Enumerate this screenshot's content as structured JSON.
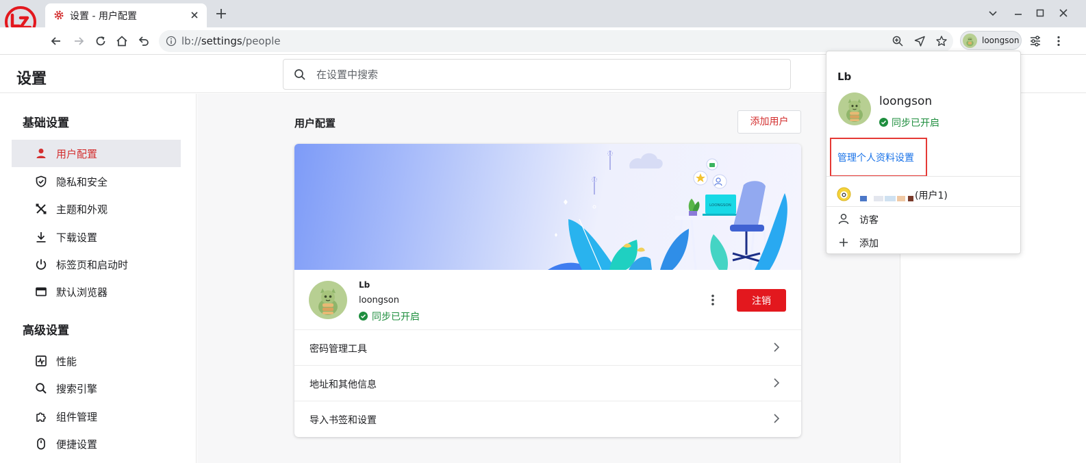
{
  "browser": {
    "tab_title": "设置 - 用户配置",
    "url_scheme": "lb://",
    "url_host": "settings",
    "url_path": "/people",
    "profile_chip_name": "loongson"
  },
  "settings": {
    "title": "设置",
    "search_placeholder": "在设置中搜索"
  },
  "sidebar": {
    "basic_title": "基础设置",
    "basic_items": [
      {
        "label": "用户配置",
        "icon": "person-icon",
        "active": true
      },
      {
        "label": "隐私和安全",
        "icon": "shield-icon"
      },
      {
        "label": "主题和外观",
        "icon": "theme-icon"
      },
      {
        "label": "下载设置",
        "icon": "download-icon"
      },
      {
        "label": "标签页和启动时",
        "icon": "power-icon"
      },
      {
        "label": "默认浏览器",
        "icon": "browser-icon"
      }
    ],
    "advanced_title": "高级设置",
    "advanced_items": [
      {
        "label": "性能",
        "icon": "performance-icon"
      },
      {
        "label": "搜索引擎",
        "icon": "search-icon"
      },
      {
        "label": "组件管理",
        "icon": "puzzle-icon"
      },
      {
        "label": "便捷设置",
        "icon": "mouse-icon"
      }
    ]
  },
  "main": {
    "heading": "用户配置",
    "add_user_label": "添加用户",
    "banner_brand": "LOONGSON",
    "profile": {
      "name": "Lb",
      "email": "loongson",
      "sync_status": "同步已开启",
      "logout_label": "注销"
    },
    "rows": [
      {
        "label": "密码管理工具"
      },
      {
        "label": "地址和其他信息"
      },
      {
        "label": "导入书签和设置"
      }
    ]
  },
  "popup": {
    "name": "Lb",
    "email": "loongson",
    "sync_status": "同步已开启",
    "manage_label": "管理个人资料设置",
    "other_user_label": "(用户1)",
    "guest_label": "访客",
    "add_label": "添加"
  },
  "colors": {
    "accent_red": "#e3181e",
    "sync_green": "#1e8e3e",
    "link_blue": "#1a73e8",
    "highlight_box": "#e53935"
  }
}
